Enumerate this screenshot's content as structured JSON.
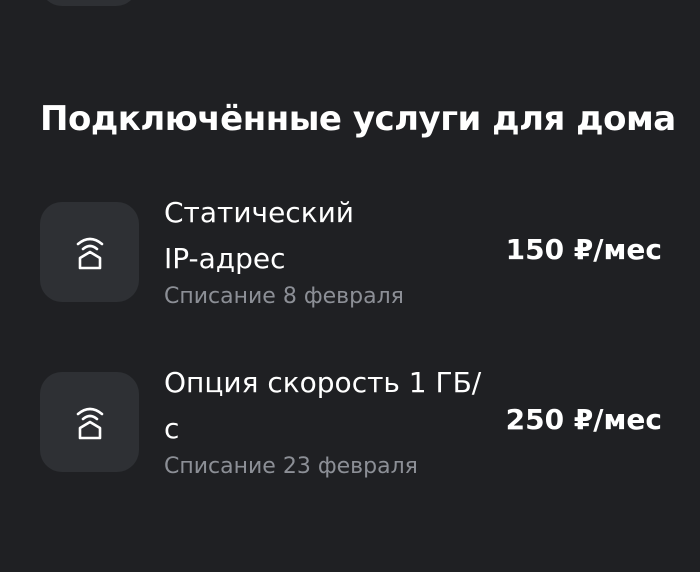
{
  "section": {
    "title": "Подключённые услуги для дома"
  },
  "services": [
    {
      "icon": "home-wifi-icon",
      "name": "Статический\nIP-адрес",
      "billing": "Списание 8 февраля",
      "price": "150 ₽/мес"
    },
    {
      "icon": "home-wifi-icon",
      "name": "Опция скорость 1 ГБ/\nс",
      "billing": "Списание 23 февраля",
      "price": "250 ₽/мес"
    }
  ],
  "colors": {
    "background": "#1f2023",
    "tile": "#2e3034",
    "text_primary": "#ffffff",
    "text_secondary": "#8c8f96"
  }
}
